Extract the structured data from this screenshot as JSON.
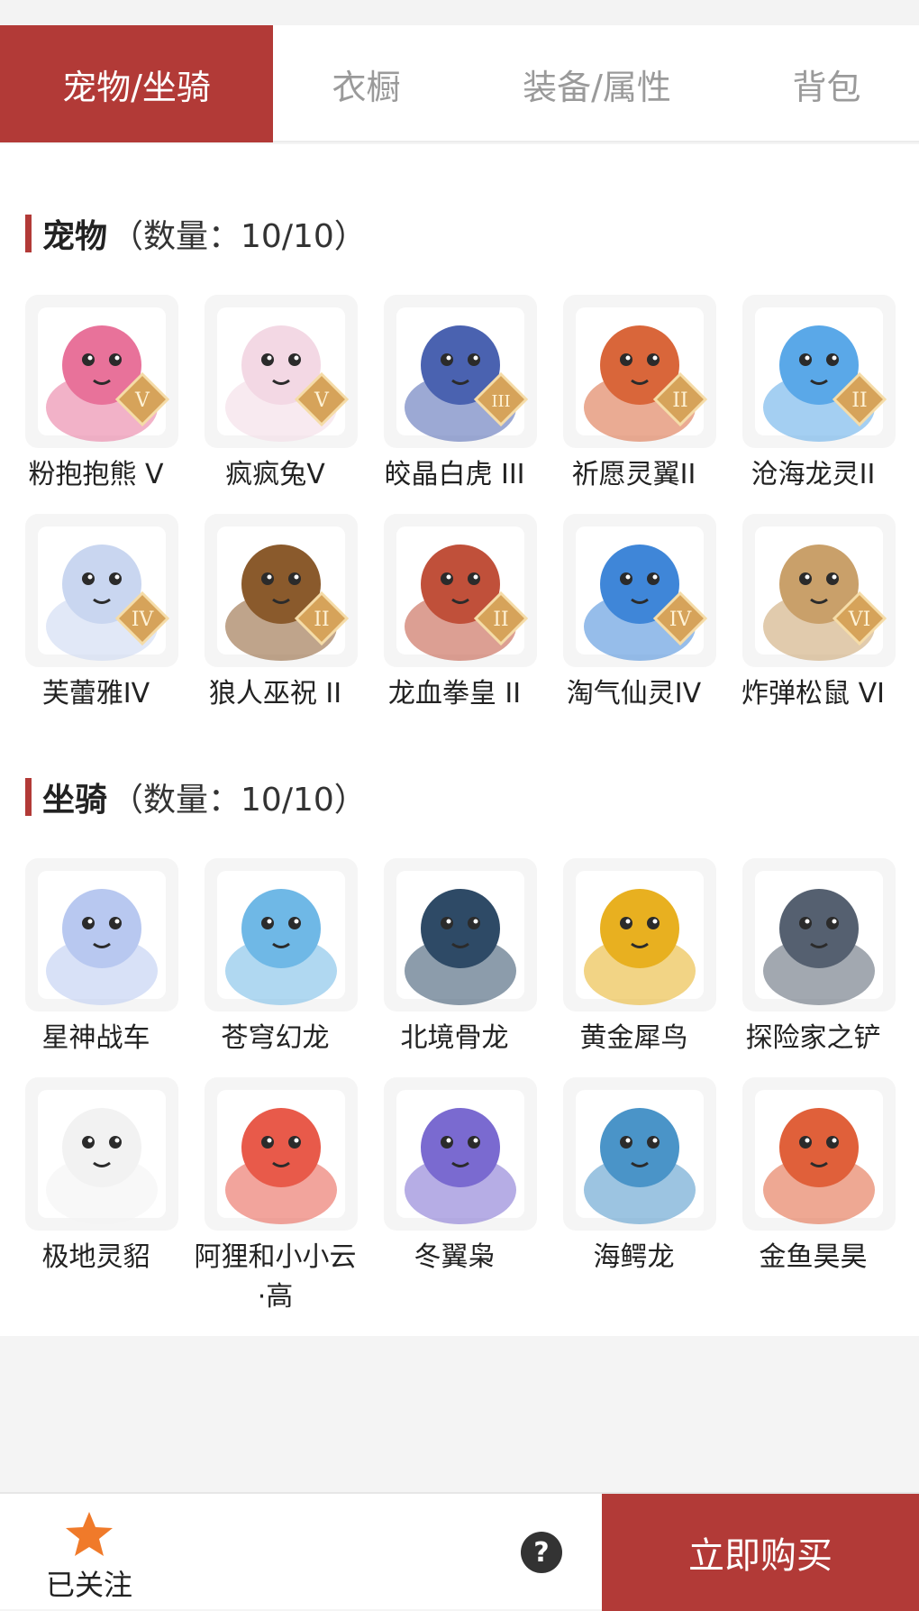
{
  "tabs": [
    {
      "label": "宠物/坐骑",
      "active": true
    },
    {
      "label": "衣橱",
      "active": false
    },
    {
      "label": "装备/属性",
      "active": false
    },
    {
      "label": "背包",
      "active": false
    }
  ],
  "pets": {
    "title": "宠物",
    "count": "（数量：10/10）",
    "items": [
      {
        "name": "粉抱抱熊 V",
        "icon": "pink-bear-icon",
        "rank": "V",
        "color": "#e8729a"
      },
      {
        "name": "疯疯兔V",
        "icon": "crazy-rabbit-icon",
        "rank": "V",
        "color": "#f3d8e4"
      },
      {
        "name": "皎晶白虎 III",
        "icon": "white-tiger-icon",
        "rank": "III",
        "color": "#4a62b0"
      },
      {
        "name": "祈愿灵翼II",
        "icon": "wish-wing-bird-icon",
        "rank": "II",
        "color": "#d9663a"
      },
      {
        "name": "沧海龙灵II",
        "icon": "sea-dragon-spirit-icon",
        "rank": "II",
        "color": "#5aa8e8"
      },
      {
        "name": "芙蕾雅IV",
        "icon": "freya-icon",
        "rank": "IV",
        "color": "#c9d6f0"
      },
      {
        "name": "狼人巫祝 II",
        "icon": "werewolf-shaman-icon",
        "rank": "II",
        "color": "#8a5a2c"
      },
      {
        "name": "龙血拳皇 II",
        "icon": "dragonblood-boxer-icon",
        "rank": "II",
        "color": "#c0503a"
      },
      {
        "name": "淘气仙灵IV",
        "icon": "naughty-fairy-icon",
        "rank": "IV",
        "color": "#3f86d8"
      },
      {
        "name": "炸弹松鼠 VI",
        "icon": "bomb-squirrel-icon",
        "rank": "VI",
        "color": "#c9a06a"
      }
    ]
  },
  "mounts": {
    "title": "坐骑",
    "count": "（数量：10/10）",
    "items": [
      {
        "name": "星神战车",
        "icon": "star-chariot-icon",
        "color": "#b8c8f0"
      },
      {
        "name": "苍穹幻龙",
        "icon": "sky-dragon-icon",
        "color": "#6fb8e6"
      },
      {
        "name": "北境骨龙",
        "icon": "north-bone-dragon-icon",
        "color": "#2e4a66"
      },
      {
        "name": "黄金犀鸟",
        "icon": "golden-hornbill-icon",
        "color": "#e8b020"
      },
      {
        "name": "探险家之铲",
        "icon": "explorer-shovel-icon",
        "color": "#556070"
      },
      {
        "name": "极地灵貂",
        "icon": "polar-mink-icon",
        "color": "#f2f2f2"
      },
      {
        "name": "阿狸和小小云·高",
        "icon": "ali-cloud-icon",
        "color": "#e85a4a"
      },
      {
        "name": "冬翼枭",
        "icon": "winter-owl-icon",
        "color": "#7a6ad0"
      },
      {
        "name": "海鳄龙",
        "icon": "sea-croc-dragon-icon",
        "color": "#4a94c8"
      },
      {
        "name": "金鱼昊昊",
        "icon": "goldfish-icon",
        "color": "#e0603a"
      }
    ]
  },
  "footer": {
    "follow_label": "已关注",
    "help_glyph": "?",
    "buy_label": "立即购买"
  },
  "accent": "#b23a37",
  "badge_color": "#d6a35a"
}
